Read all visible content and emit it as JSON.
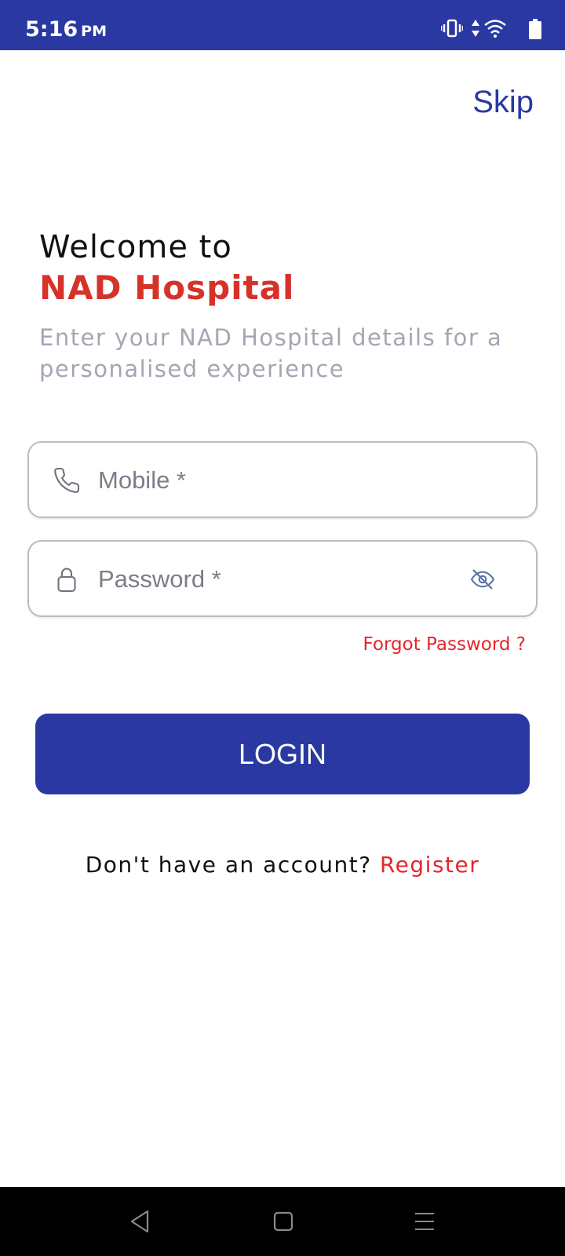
{
  "status_bar": {
    "time": "5:16",
    "ampm": "PM",
    "icons": [
      "vibrate-icon",
      "data-arrows-icon",
      "wifi-icon",
      "battery-icon"
    ]
  },
  "header": {
    "skip_label": "Skip"
  },
  "welcome": {
    "line1": "Welcome to",
    "hospital_name": "NAD Hospital",
    "subtitle": "Enter your NAD Hospital details for a personalised experience"
  },
  "form": {
    "mobile": {
      "placeholder": "Mobile *",
      "value": "",
      "icon": "phone-icon"
    },
    "password": {
      "placeholder": "Password *",
      "value": "",
      "icon": "lock-icon",
      "toggle_icon": "eye-off-icon"
    },
    "forgot_label": "Forgot Password ?",
    "login_label": "LOGIN"
  },
  "register": {
    "prompt": "Don't have an account?",
    "link": "Register"
  },
  "nav_bar": {
    "icons": [
      "back-icon",
      "home-icon",
      "menu-icon"
    ]
  },
  "colors": {
    "primary": "#2a39a2",
    "accent_red": "#d6322a",
    "link_red": "#e8242b"
  }
}
